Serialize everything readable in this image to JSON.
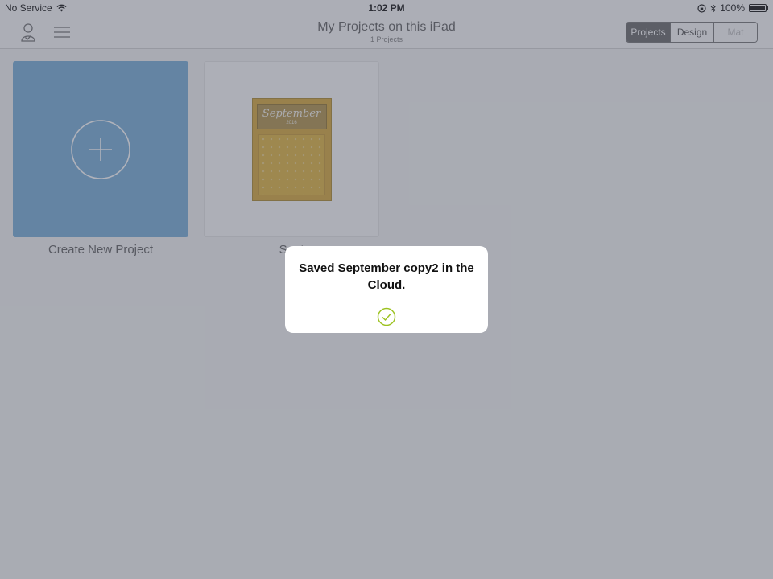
{
  "status_bar": {
    "carrier": "No Service",
    "time": "1:02 PM",
    "battery": "100%"
  },
  "nav": {
    "title": "My Projects on this iPad",
    "subtitle": "1 Projects",
    "segments": [
      "Projects",
      "Design",
      "Mat"
    ],
    "active_segment": "Projects",
    "icons": [
      "account-icon",
      "menu-icon"
    ]
  },
  "projects": {
    "new_label": "Create New Project",
    "items": [
      {
        "label": "Sept",
        "thumbnail_title": "September",
        "thumbnail_sub": "2016"
      }
    ]
  },
  "toast": {
    "message": "Saved September copy2 in the Cloud.",
    "icon": "checkmark-circle-icon",
    "accent": "#9cc21f"
  }
}
